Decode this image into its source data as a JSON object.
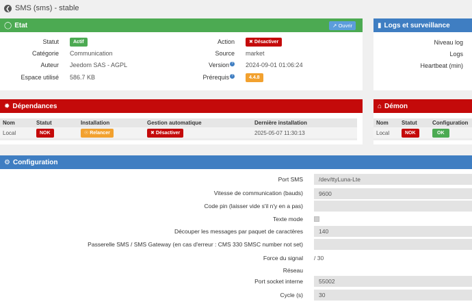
{
  "page": {
    "title": "SMS (sms) - stable"
  },
  "etat": {
    "title": "Etat",
    "open_button": "Ouvrir",
    "fields": {
      "statut_label": "Statut",
      "statut_value": "Actif",
      "categorie_label": "Catégorie",
      "categorie_value": "Communication",
      "auteur_label": "Auteur",
      "auteur_value": "Jeedom SAS - AGPL",
      "espace_label": "Espace utilisé",
      "espace_value": "586.7 KB",
      "action_label": "Action",
      "action_button": "Désactiver",
      "source_label": "Source",
      "source_value": "market",
      "version_label": "Version",
      "version_value": "2024-09-01 01:06:24",
      "prerequis_label": "Prérequis",
      "prerequis_value": "4.4.8"
    }
  },
  "logs": {
    "title": "Logs et surveillance",
    "rows": [
      "Niveau log",
      "Logs",
      "Heartbeat (min)"
    ]
  },
  "dependances": {
    "title": "Dépendances",
    "headers": [
      "Nom",
      "Statut",
      "Installation",
      "Gestion automatique",
      "Dernière installation"
    ],
    "row": {
      "nom": "Local",
      "statut": "NOK",
      "installation": "Relancer",
      "gestion": "Désactiver",
      "derniere": "2025-05-07 11:30:13"
    }
  },
  "demon": {
    "title": "Démon",
    "headers": [
      "Nom",
      "Statut",
      "Configuration"
    ],
    "row": {
      "nom": "Local",
      "statut": "NOK",
      "configuration": "OK"
    }
  },
  "configuration": {
    "title": "Configuration",
    "fields": [
      {
        "label": "Port SMS",
        "value": "/dev/ttyLuna-Lte"
      },
      {
        "label": "Vitesse de communication (bauds)",
        "value": "9600"
      },
      {
        "label": "Code pin (laisser vide s'il n'y en a pas)",
        "value": ""
      },
      {
        "label": "Texte mode",
        "value": ""
      },
      {
        "label": "Découper les messages par paquet de caractères",
        "value": "140"
      },
      {
        "label": "Passerelle SMS / SMS Gateway (en cas d'erreur : CMS 330 SMSC number not set)",
        "value": ""
      },
      {
        "label": "Force du signal",
        "value": "/ 30"
      },
      {
        "label": "Réseau",
        "value": ""
      },
      {
        "label": "Port socket interne",
        "value": "55002"
      },
      {
        "label": "Cycle (s)",
        "value": "30"
      }
    ]
  },
  "colors": {
    "green": "#4caa52",
    "red": "#c40a0a",
    "blue": "#3f7ec2",
    "orange": "#f2a12f"
  }
}
